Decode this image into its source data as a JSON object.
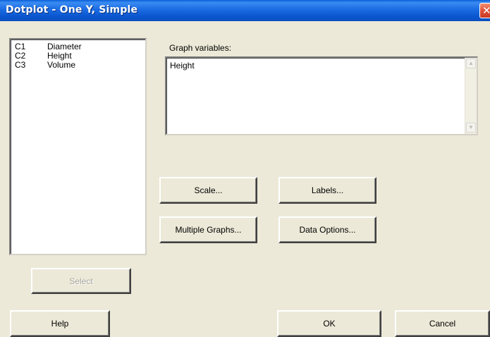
{
  "window": {
    "title": "Dotplot - One Y, Simple",
    "close_glyph": "✕"
  },
  "variables": [
    {
      "column": "C1",
      "name": "Diameter"
    },
    {
      "column": "C2",
      "name": "Height"
    },
    {
      "column": "C3",
      "name": "Volume"
    }
  ],
  "graph_variables": {
    "label": "Graph variables:",
    "value": "Height"
  },
  "buttons": {
    "scale": "Scale...",
    "labels": "Labels...",
    "multiple_graphs": "Multiple Graphs...",
    "data_options": "Data Options...",
    "select": "Select",
    "help": "Help",
    "ok": "OK",
    "cancel": "Cancel"
  },
  "icons": {
    "close": "close-icon",
    "scroll_up": "scroll-up-icon",
    "scroll_down": "scroll-down-icon"
  },
  "colors": {
    "titlebar": "#0b57d0",
    "dialog_bg": "#ece9d8",
    "close_button": "#e0503a"
  }
}
